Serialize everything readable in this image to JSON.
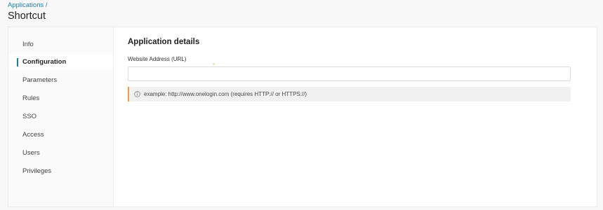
{
  "header": {
    "breadcrumb": "Applications /",
    "title": "Shortcut"
  },
  "sidebar": {
    "items": [
      {
        "label": "Info"
      },
      {
        "label": "Configuration"
      },
      {
        "label": "Parameters"
      },
      {
        "label": "Rules"
      },
      {
        "label": "SSO"
      },
      {
        "label": "Access"
      },
      {
        "label": "Users"
      },
      {
        "label": "Privileges"
      }
    ],
    "active": "Configuration",
    "active_color": "#1a7fa6"
  },
  "main": {
    "section_title": "Application details",
    "url_field": {
      "label": "Website Address (URL)",
      "value": "",
      "placeholder": ""
    },
    "hint": {
      "icon": "info-icon",
      "text": "example: http://www.onelogin.com (requires HTTP:// or HTTPS://)",
      "accent_color": "#e8a04a"
    }
  }
}
